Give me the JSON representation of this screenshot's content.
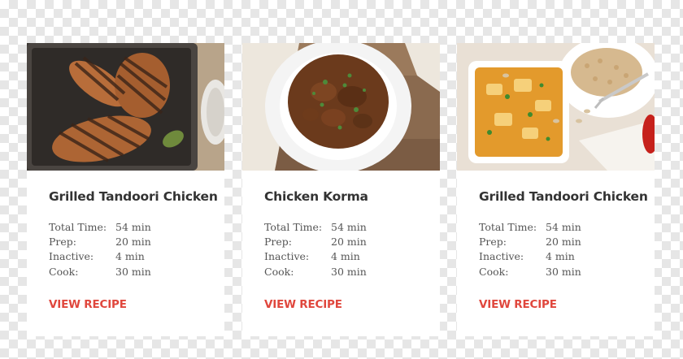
{
  "theme": {
    "accent": "#e0473d",
    "title_color": "#333333",
    "text_color": "#555555"
  },
  "cards": [
    {
      "image": "grilled tandoori chicken on grill pan",
      "title": "Grilled Tandoori Chicken",
      "times": [
        {
          "label": "Total Time:",
          "value": "54 min"
        },
        {
          "label": "Prep:",
          "value": "20 min"
        },
        {
          "label": "Inactive:",
          "value": "4 min"
        },
        {
          "label": "Cook:",
          "value": "30 min"
        }
      ],
      "cta": "VIEW RECIPE"
    },
    {
      "image": "chicken korma in white bowl",
      "title": "Chicken Korma",
      "times": [
        {
          "label": "Total Time:",
          "value": "54 min"
        },
        {
          "label": "Prep:",
          "value": "20 min"
        },
        {
          "label": "Inactive:",
          "value": "4 min"
        },
        {
          "label": "Cook:",
          "value": "30 min"
        }
      ],
      "cta": "VIEW RECIPE"
    },
    {
      "image": "curry dish with rice and fork",
      "title": "Grilled Tandoori Chicken",
      "times": [
        {
          "label": "Total Time:",
          "value": "54 min"
        },
        {
          "label": "Prep:",
          "value": "20 min"
        },
        {
          "label": "Inactive:",
          "value": "4 min"
        },
        {
          "label": "Cook:",
          "value": "30 min"
        }
      ],
      "cta": "VIEW RECIPE"
    }
  ]
}
